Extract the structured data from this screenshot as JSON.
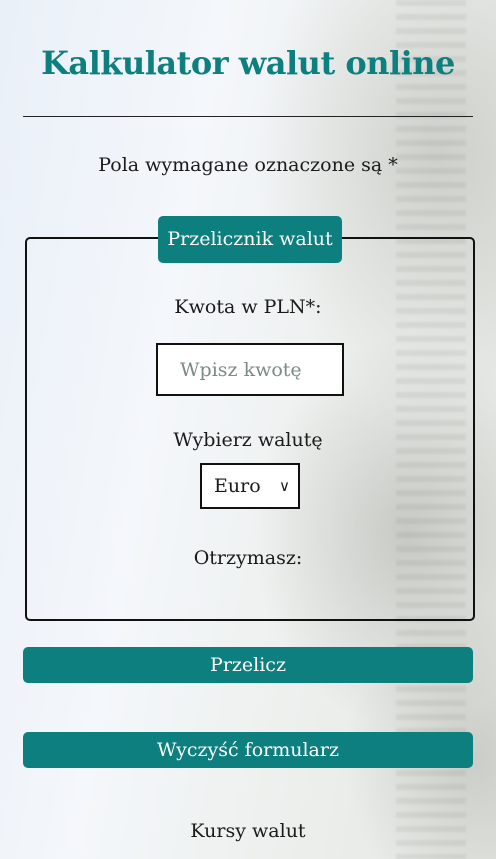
{
  "page": {
    "title": "Kalkulator walut online",
    "required_note": "Pola wymagane oznaczone są *"
  },
  "converter": {
    "legend": "Przelicznik walut",
    "amount_label": "Kwota w PLN*:",
    "amount_placeholder": "Wpisz kwotę",
    "amount_value": "",
    "currency_label": "Wybierz walutę",
    "currency_selected": "Euro",
    "result_label": "Otrzymasz:"
  },
  "actions": {
    "convert_label": "Przelicz",
    "clear_label": "Wyczyść formularz"
  },
  "footer": {
    "rates_heading": "Kursy walut"
  },
  "colors": {
    "accent": "#0e7f7f"
  }
}
